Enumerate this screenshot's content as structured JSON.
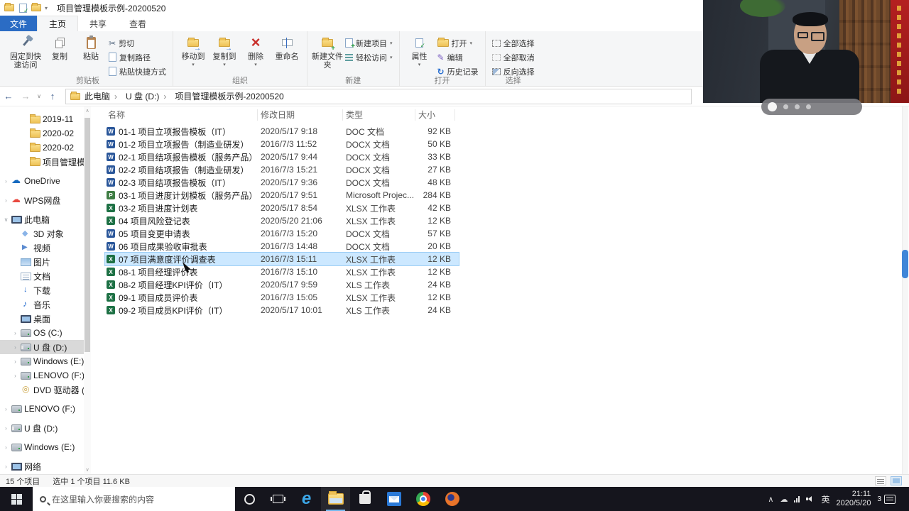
{
  "titlebar": {
    "title": "项目管理模板示例-20200520"
  },
  "tabs": [
    {
      "name": "tab-file",
      "label": "文件",
      "cls": "file-tab"
    },
    {
      "name": "tab-home",
      "label": "主页",
      "active": true
    },
    {
      "name": "tab-share",
      "label": "共享"
    },
    {
      "name": "tab-view",
      "label": "查看"
    }
  ],
  "ribbon": {
    "clipboard": {
      "label": "剪贴板",
      "pin": "固定到快速访问",
      "copy": "复制",
      "paste": "粘贴",
      "cut": "剪切",
      "copy_path": "复制路径",
      "paste_shortcut": "粘贴快捷方式"
    },
    "organize": {
      "label": "组织",
      "move_to": "移动到",
      "copy_to": "复制到",
      "delete": "删除",
      "rename": "重命名"
    },
    "new": {
      "label": "新建",
      "new_folder": "新建文件夹",
      "new_item": "新建项目",
      "easy_access": "轻松访问"
    },
    "open": {
      "label": "打开",
      "properties": "属性",
      "open": "打开",
      "edit": "编辑",
      "history": "历史记录"
    },
    "select": {
      "label": "选择",
      "select_all": "全部选择",
      "select_none": "全部取消",
      "invert_selection": "反向选择"
    }
  },
  "nav": {
    "crumbs": [
      "此电脑",
      "U 盘 (D:)",
      "项目管理模板示例-20200520"
    ]
  },
  "sidebar": {
    "items": [
      {
        "label": "2019-11",
        "icon": "folder",
        "indent": 2
      },
      {
        "label": "2020-02",
        "icon": "folder",
        "indent": 2
      },
      {
        "label": "2020-02",
        "icon": "folder",
        "indent": 2
      },
      {
        "label": "项目管理模板示例",
        "icon": "folder",
        "indent": 2
      },
      {
        "label": "OneDrive",
        "icon": "onedrive",
        "indent": 0,
        "caret": "right",
        "gap": true
      },
      {
        "label": "WPS网盘",
        "icon": "wpscloud",
        "indent": 0,
        "caret": "right",
        "gap": true
      },
      {
        "label": "此电脑",
        "icon": "computer",
        "indent": 0,
        "caret": "down",
        "gap": true
      },
      {
        "label": "3D 对象",
        "icon": "cube",
        "indent": 1
      },
      {
        "label": "视频",
        "icon": "video",
        "indent": 1
      },
      {
        "label": "图片",
        "icon": "picture",
        "indent": 1
      },
      {
        "label": "文档",
        "icon": "doc",
        "indent": 1
      },
      {
        "label": "下载",
        "icon": "download",
        "indent": 1
      },
      {
        "label": "音乐",
        "icon": "music",
        "indent": 1
      },
      {
        "label": "桌面",
        "icon": "desktop",
        "indent": 1
      },
      {
        "label": "OS (C:)",
        "icon": "drive",
        "indent": 1,
        "caret": "right"
      },
      {
        "label": "U 盘 (D:)",
        "icon": "usb",
        "indent": 1,
        "caret": "right",
        "selected": true
      },
      {
        "label": "Windows (E:)",
        "icon": "drive",
        "indent": 1,
        "caret": "right"
      },
      {
        "label": "LENOVO (F:)",
        "icon": "drive",
        "indent": 1,
        "caret": "right"
      },
      {
        "label": "DVD 驱动器 (G:)",
        "icon": "dvd",
        "indent": 1
      },
      {
        "label": "LENOVO (F:)",
        "icon": "drive",
        "indent": 0,
        "caret": "right",
        "gap": true
      },
      {
        "label": "U 盘 (D:)",
        "icon": "usb",
        "indent": 0,
        "caret": "right",
        "gap": true
      },
      {
        "label": "Windows (E:)",
        "icon": "drive",
        "indent": 0,
        "caret": "right",
        "gap": true
      },
      {
        "label": "网络",
        "icon": "network",
        "indent": 0,
        "caret": "right",
        "gap": true
      }
    ]
  },
  "files": {
    "columns": {
      "name": "名称",
      "date": "修改日期",
      "type": "类型",
      "size": "大小"
    },
    "rows": [
      {
        "name": "01-1 项目立项报告模板（IT）",
        "date": "2020/5/17 9:18",
        "type": "DOC 文档",
        "size": "92 KB",
        "badge": "word",
        "badge_letter": "W"
      },
      {
        "name": "01-2 项目立项报告（制造业研发）",
        "date": "2016/7/3 11:52",
        "type": "DOCX 文档",
        "size": "50 KB",
        "badge": "word",
        "badge_letter": "W"
      },
      {
        "name": "02-1 项目结项报告模板（服务产品）",
        "date": "2020/5/17 9:44",
        "type": "DOCX 文档",
        "size": "33 KB",
        "badge": "word",
        "badge_letter": "W"
      },
      {
        "name": "02-2 项目结项报告（制造业研发）",
        "date": "2016/7/3 15:21",
        "type": "DOCX 文档",
        "size": "27 KB",
        "badge": "word",
        "badge_letter": "W"
      },
      {
        "name": "02-3 项目结项报告模板（IT）",
        "date": "2020/5/17 9:36",
        "type": "DOCX 文档",
        "size": "48 KB",
        "badge": "word",
        "badge_letter": "W"
      },
      {
        "name": "03-1 项目进度计划模板（服务产品）",
        "date": "2020/5/17 9:51",
        "type": "Microsoft Projec...",
        "size": "284 KB",
        "badge": "project",
        "badge_letter": "P"
      },
      {
        "name": "03-2 项目进度计划表",
        "date": "2020/5/17 8:54",
        "type": "XLSX 工作表",
        "size": "42 KB",
        "badge": "excel",
        "badge_letter": "X"
      },
      {
        "name": "04 项目风险登记表",
        "date": "2020/5/20 21:06",
        "type": "XLSX 工作表",
        "size": "12 KB",
        "badge": "excel",
        "badge_letter": "X"
      },
      {
        "name": "05 项目变更申请表",
        "date": "2016/7/3 15:20",
        "type": "DOCX 文档",
        "size": "57 KB",
        "badge": "word",
        "badge_letter": "W"
      },
      {
        "name": "06 项目成果验收审批表",
        "date": "2016/7/3 14:48",
        "type": "DOCX 文档",
        "size": "20 KB",
        "badge": "word",
        "badge_letter": "W"
      },
      {
        "name": "07 项目满意度评价调查表",
        "date": "2016/7/3 15:11",
        "type": "XLSX 工作表",
        "size": "12 KB",
        "badge": "excel",
        "badge_letter": "X",
        "selected": true
      },
      {
        "name": "08-1 项目经理评价表",
        "date": "2016/7/3 15:10",
        "type": "XLSX 工作表",
        "size": "12 KB",
        "badge": "excel",
        "badge_letter": "X"
      },
      {
        "name": "08-2 项目经理KPI评价（IT）",
        "date": "2020/5/17 9:59",
        "type": "XLS 工作表",
        "size": "24 KB",
        "badge": "excel",
        "badge_letter": "X"
      },
      {
        "name": "09-1 项目成员评价表",
        "date": "2016/7/3 15:05",
        "type": "XLSX 工作表",
        "size": "12 KB",
        "badge": "excel",
        "badge_letter": "X"
      },
      {
        "name": "09-2 项目成员KPI评价（IT）",
        "date": "2020/5/17 10:01",
        "type": "XLS 工作表",
        "size": "24 KB",
        "badge": "excel",
        "badge_letter": "X"
      }
    ]
  },
  "status": {
    "total": "15 个项目",
    "selected": "选中 1 个项目 11.6 KB"
  },
  "taskbar": {
    "search_placeholder": "在这里输入你要搜索的内容",
    "icons": [
      {
        "name": "edge-icon",
        "icon": "edge"
      },
      {
        "name": "file-explorer-icon",
        "icon": "explorer",
        "active": true
      },
      {
        "name": "store-icon",
        "icon": "store"
      },
      {
        "name": "mail-icon",
        "icon": "mail"
      },
      {
        "name": "chrome-icon",
        "icon": "chrome"
      },
      {
        "name": "firefox-icon",
        "icon": "firefox"
      }
    ],
    "tray": {
      "lang": "英",
      "time": "21:11",
      "date": "2020/5/20",
      "notifications": "3"
    }
  }
}
